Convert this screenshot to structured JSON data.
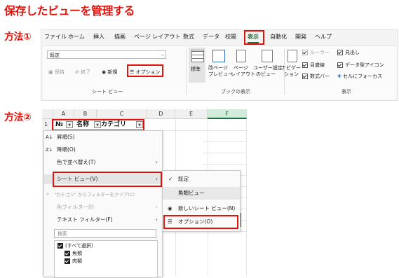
{
  "page": {
    "title": "保存したビューを管理する",
    "method1": "方法①",
    "method2": "方法②"
  },
  "ribbon": {
    "tabs": [
      "ファイル",
      "ホーム",
      "挿入",
      "描画",
      "ページ レイアウト",
      "数式",
      "データ",
      "校閲",
      "表示",
      "自動化",
      "開発",
      "ヘルプ"
    ],
    "active_tab": "表示",
    "sheet_view": {
      "combo_value": "既定",
      "keep": "保持",
      "exit": "終了",
      "new": "新規",
      "options": "オプション",
      "group_label": "シート ビュー"
    },
    "workbook_views": {
      "normal": "標準",
      "page_break_1": "改ページ",
      "page_break_2": "プレビュー",
      "page_layout_1": "ページ",
      "page_layout_2": "レイアウト",
      "custom_1": "ユーザー設定",
      "custom_2": "のビュー",
      "group_label": "ブックの表示"
    },
    "show": {
      "navigation_1": "ナビゲー",
      "navigation_2": "ション",
      "ruler": "ルーラー",
      "gridlines": "目盛線",
      "formula_bar": "数式バー",
      "headings": "見出し",
      "data_type_icons": "データ型アイコン",
      "focus_cell": "セルにフォーカス",
      "group_label": "表示"
    }
  },
  "grid": {
    "columns": [
      "A",
      "B",
      "C",
      "D",
      "E",
      "F"
    ],
    "row_number": "1",
    "headers": [
      "№",
      "名称",
      "カテゴリ"
    ]
  },
  "filter_menu": {
    "sort_asc": "昇順(S)",
    "sort_desc": "降順(O)",
    "sort_by_color": "色で並べ替え(T)",
    "sheet_view": "シート ビュー(V)",
    "clear_filter": "\"カテゴリ\" からフィルターをクリア(C)",
    "color_filter": "色フィルター(I)",
    "text_filter": "テキスト フィルター(F)",
    "search_placeholder": "検索",
    "list": [
      "(すべて選択)",
      "魚類",
      "肉類"
    ]
  },
  "submenu": {
    "default": "既定",
    "fish_view": "魚類ビュー",
    "new_sheet_view": "新しいシート ビュー(N)",
    "options": "オプション(O)"
  },
  "colors": {
    "accent_red": "#e3120b",
    "excel_green": "#1e7145"
  }
}
